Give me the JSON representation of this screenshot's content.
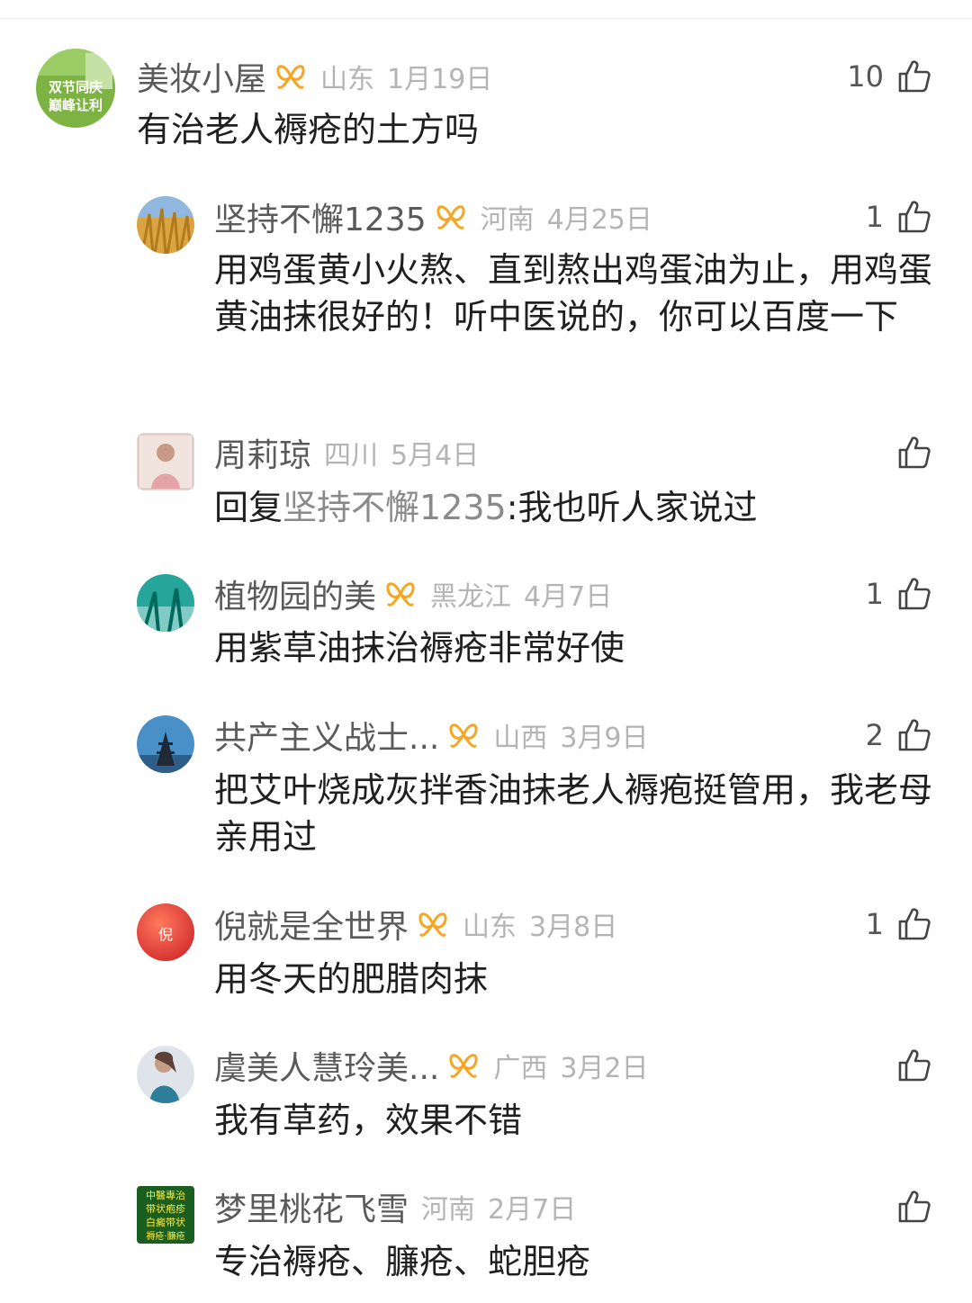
{
  "comments": [
    {
      "username": "美妆小屋",
      "location": "山东",
      "date": "1月19日",
      "likes": "10",
      "text": "有治老人褥疮的土方吗",
      "vip": true
    },
    {
      "username": "坚持不懈1235",
      "location": "河南",
      "date": "4月25日",
      "likes": "1",
      "text": "用鸡蛋黄小火熬、直到熬出鸡蛋油为止，用鸡蛋黄油抹很好的！听中医说的，你可以百度一下",
      "vip": true
    },
    {
      "username": "周莉琼",
      "location": "四川",
      "date": "5月4日",
      "likes": "",
      "reply_prefix": "回复",
      "reply_target": "坚持不懈1235",
      "text": ":我也听人家说过",
      "vip": false
    },
    {
      "username": "植物园的美",
      "location": "黑龙江",
      "date": "4月7日",
      "likes": "1",
      "text": "用紫草油抹治褥疮非常好使",
      "vip": true
    },
    {
      "username": "共产主义战士...",
      "location": "山西",
      "date": "3月9日",
      "likes": "2",
      "text": "把艾叶烧成灰拌香油抹老人褥疱挺管用，我老母亲用过",
      "vip": true
    },
    {
      "username": "倪就是全世界",
      "location": "山东",
      "date": "3月8日",
      "likes": "1",
      "text": "用冬天的肥腊肉抹",
      "vip": true
    },
    {
      "username": "虞美人慧玲美...",
      "location": "广西",
      "date": "3月2日",
      "likes": "",
      "text": "我有草药，效果不错",
      "vip": true
    },
    {
      "username": "梦里桃花飞雪",
      "location": "河南",
      "date": "2月7日",
      "likes": "",
      "text": "专治褥疮、臁疮、蛇胆疮",
      "vip": false
    }
  ],
  "avatars": [
    {
      "lines": [
        "双节同庆",
        "巅峰让利"
      ]
    },
    {
      "lines": []
    },
    {
      "lines": []
    },
    {
      "lines": []
    },
    {
      "lines": []
    },
    {
      "lines": [
        "倪"
      ]
    },
    {
      "lines": []
    },
    {
      "lines": [
        "中醫專治",
        "带状疱疹",
        "白癜带状",
        "褥疮·臁疮"
      ]
    }
  ],
  "colors": {
    "vip": "#f5a623",
    "meta": "#b4b4b4",
    "username": "#5a5a5a",
    "reply_target": "#8a8a8a"
  }
}
